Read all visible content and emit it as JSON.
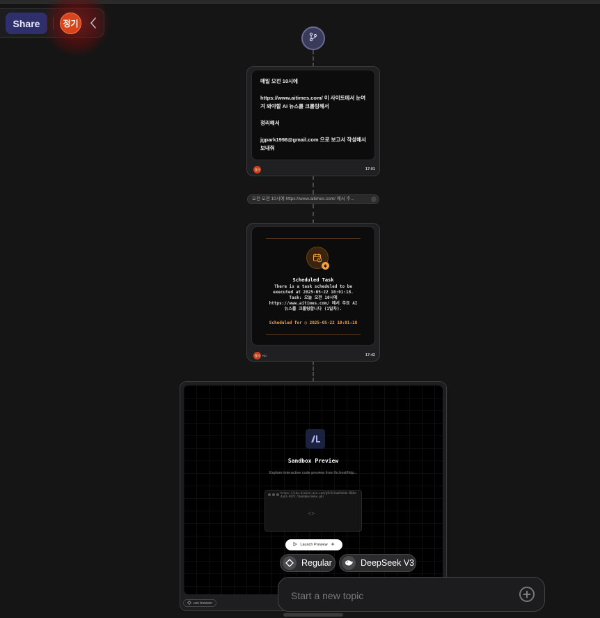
{
  "header": {
    "share_label": "Share",
    "avatar_label": "정기"
  },
  "flow": {
    "message_card": {
      "text": "매일 오전 10시에\n\nhttps://www.aitimes.com/ 이 사이트에서 눈여겨 봐야할 AI 뉴스를 크롤링해서\n\n정리해서\n\njgpark1998@gmail.com 으로 보고서 작성해서 보내줘",
      "avatar_label": "정기",
      "time": "17:01"
    },
    "pill_text": "오전 오전 10시에 https://www.aitimes.com/ 에서 주...",
    "scheduled_card": {
      "title": "Scheduled Task",
      "description": "There is a task scheduled to be executed at 2025-05-22 10:01:18. Task: 오늘 오전 10시에 https://www.aitimes.com/ 에서 주요 AI 뉴스를 크롤링합니다 (1일차).",
      "scheduled_for": "Scheduled for ◷ 2025-05-22 10:01:18",
      "avatar_label": "정기",
      "tag": "No",
      "time": "17:42"
    },
    "sandbox": {
      "title": "Sandbox Preview",
      "description": "Explore interactive code preview from llo.host/http...",
      "url_text": "https://sbx.dialen-ace.com/g9r8/baa84eda-866e-4ab1-9bf2-5ba0a8ec9e6e.g9r",
      "code_glyph": "<>",
      "launch_label": "Launch Preview",
      "use_browser_label": "use browser"
    }
  },
  "composer": {
    "mode_regular": "Regular",
    "mode_model": "DeepSeek V3",
    "placeholder": "Start a new topic"
  }
}
